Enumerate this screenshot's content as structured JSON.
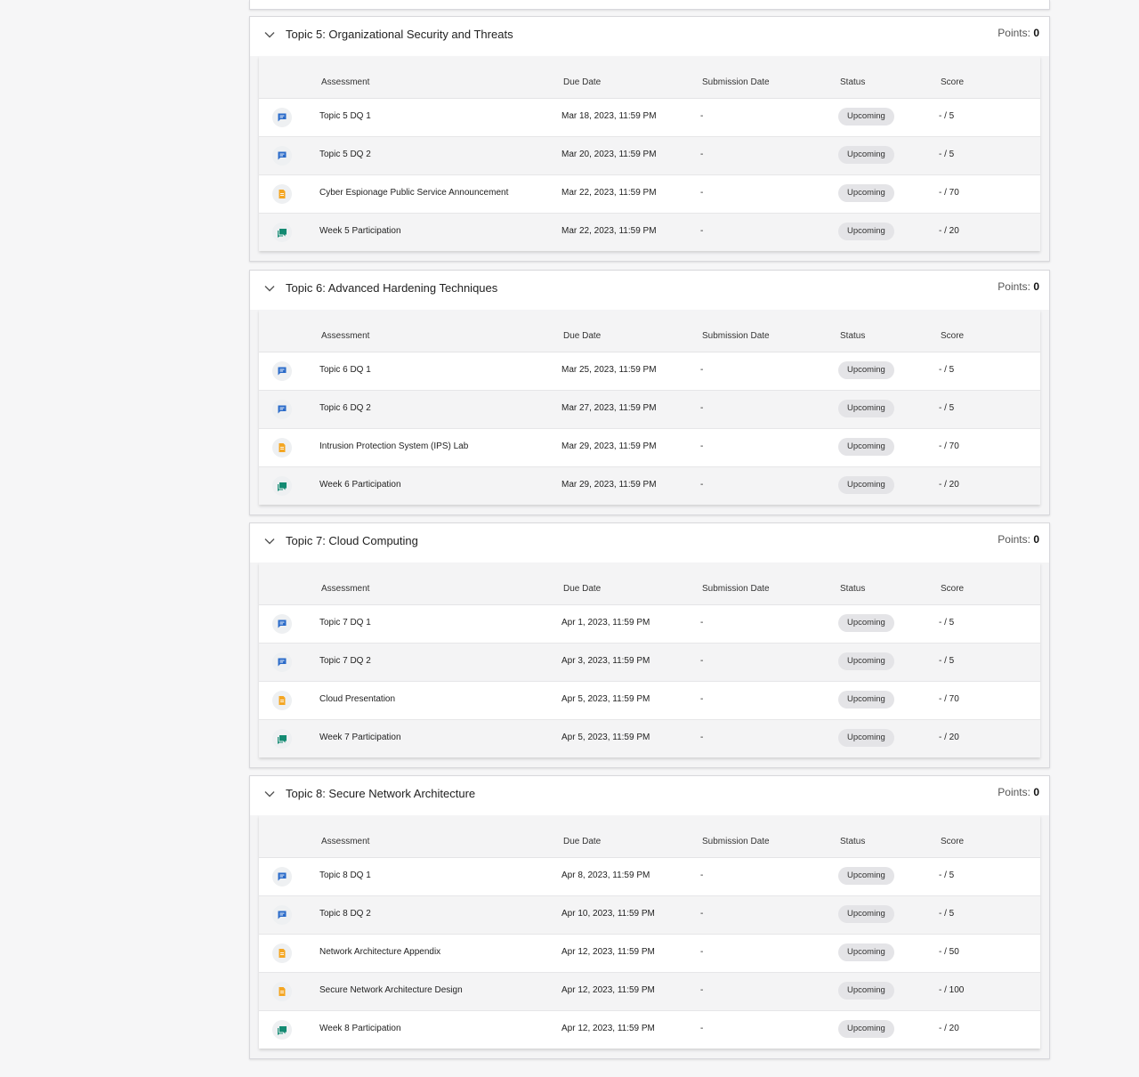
{
  "columns": {
    "assessment": "Assessment",
    "due_date": "Due Date",
    "submission_date": "Submission Date",
    "status": "Status",
    "score": "Score"
  },
  "points_label": "Points:",
  "colors": {
    "discussion": "#2b6bc9",
    "assignment": "#f4a623",
    "participation": "#138a72"
  },
  "topics": [
    {
      "title": "Topic 5: Organizational Security and Threats",
      "points": "0",
      "rows": [
        {
          "icon": "discussion-icon",
          "name": "Topic 5 DQ 1",
          "due": "Mar 18, 2023, 11:59 PM",
          "submitted": "-",
          "status": "Upcoming",
          "score": "- / 5"
        },
        {
          "icon": "discussion-icon",
          "name": "Topic 5 DQ 2",
          "due": "Mar 20, 2023, 11:59 PM",
          "submitted": "-",
          "status": "Upcoming",
          "score": "- / 5"
        },
        {
          "icon": "assignment-icon",
          "name": "Cyber Espionage Public Service Announcement",
          "due": "Mar 22, 2023, 11:59 PM",
          "submitted": "-",
          "status": "Upcoming",
          "score": "- / 70"
        },
        {
          "icon": "participation-icon",
          "name": "Week 5 Participation",
          "due": "Mar 22, 2023, 11:59 PM",
          "submitted": "-",
          "status": "Upcoming",
          "score": "- / 20"
        }
      ]
    },
    {
      "title": "Topic 6: Advanced Hardening Techniques",
      "points": "0",
      "rows": [
        {
          "icon": "discussion-icon",
          "name": "Topic 6 DQ 1",
          "due": "Mar 25, 2023, 11:59 PM",
          "submitted": "-",
          "status": "Upcoming",
          "score": "- / 5"
        },
        {
          "icon": "discussion-icon",
          "name": "Topic 6 DQ 2",
          "due": "Mar 27, 2023, 11:59 PM",
          "submitted": "-",
          "status": "Upcoming",
          "score": "- / 5"
        },
        {
          "icon": "assignment-icon",
          "name": "Intrusion Protection System (IPS) Lab",
          "due": "Mar 29, 2023, 11:59 PM",
          "submitted": "-",
          "status": "Upcoming",
          "score": "- / 70"
        },
        {
          "icon": "participation-icon",
          "name": "Week 6 Participation",
          "due": "Mar 29, 2023, 11:59 PM",
          "submitted": "-",
          "status": "Upcoming",
          "score": "- / 20"
        }
      ]
    },
    {
      "title": "Topic 7: Cloud Computing",
      "points": "0",
      "rows": [
        {
          "icon": "discussion-icon",
          "name": "Topic 7 DQ 1",
          "due": "Apr 1, 2023, 11:59 PM",
          "submitted": "-",
          "status": "Upcoming",
          "score": "- / 5"
        },
        {
          "icon": "discussion-icon",
          "name": "Topic 7 DQ 2",
          "due": "Apr 3, 2023, 11:59 PM",
          "submitted": "-",
          "status": "Upcoming",
          "score": "- / 5"
        },
        {
          "icon": "assignment-icon",
          "name": "Cloud Presentation",
          "due": "Apr 5, 2023, 11:59 PM",
          "submitted": "-",
          "status": "Upcoming",
          "score": "- / 70"
        },
        {
          "icon": "participation-icon",
          "name": "Week 7 Participation",
          "due": "Apr 5, 2023, 11:59 PM",
          "submitted": "-",
          "status": "Upcoming",
          "score": "- / 20"
        }
      ]
    },
    {
      "title": "Topic 8: Secure Network Architecture",
      "points": "0",
      "rows": [
        {
          "icon": "discussion-icon",
          "name": "Topic 8 DQ 1",
          "due": "Apr 8, 2023, 11:59 PM",
          "submitted": "-",
          "status": "Upcoming",
          "score": "- / 5"
        },
        {
          "icon": "discussion-icon",
          "name": "Topic 8 DQ 2",
          "due": "Apr 10, 2023, 11:59 PM",
          "submitted": "-",
          "status": "Upcoming",
          "score": "- / 5"
        },
        {
          "icon": "assignment-icon",
          "name": "Network Architecture Appendix",
          "due": "Apr 12, 2023, 11:59 PM",
          "submitted": "-",
          "status": "Upcoming",
          "score": "- / 50"
        },
        {
          "icon": "assignment-icon",
          "name": "Secure Network Architecture Design",
          "due": "Apr 12, 2023, 11:59 PM",
          "submitted": "-",
          "status": "Upcoming",
          "score": "- / 100"
        },
        {
          "icon": "participation-icon",
          "name": "Week 8 Participation",
          "due": "Apr 12, 2023, 11:59 PM",
          "submitted": "-",
          "status": "Upcoming",
          "score": "- / 20"
        }
      ]
    }
  ]
}
